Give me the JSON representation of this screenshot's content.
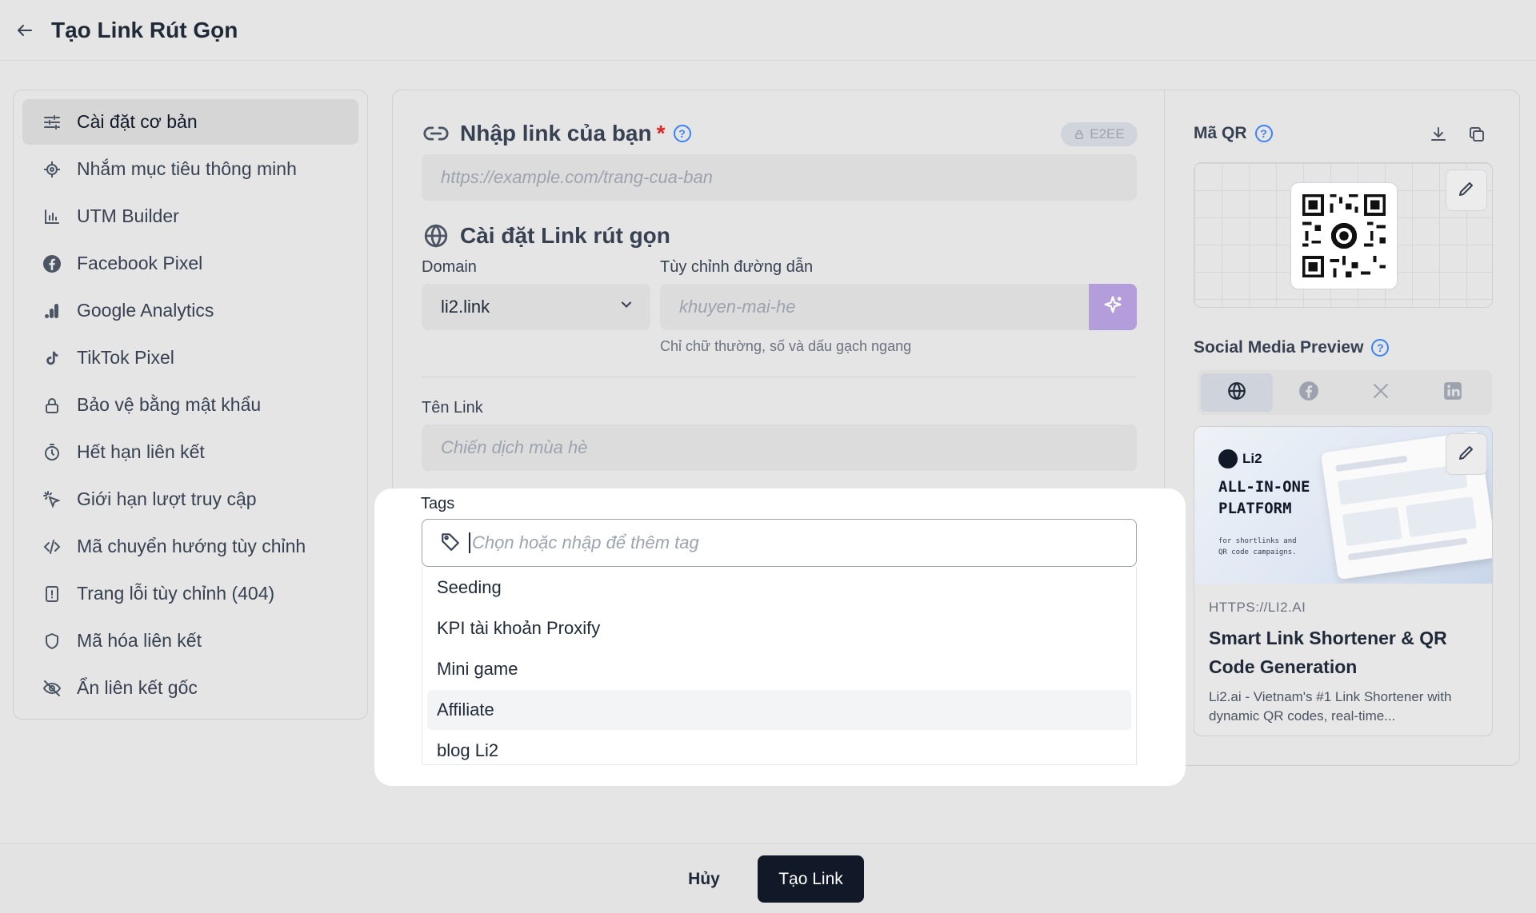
{
  "header": {
    "title": "Tạo Link Rút Gọn"
  },
  "sidebar": {
    "items": [
      {
        "label": "Cài đặt cơ bản",
        "icon": "sliders-icon",
        "active": true
      },
      {
        "label": "Nhắm mục tiêu thông minh",
        "icon": "target-icon"
      },
      {
        "label": "UTM Builder",
        "icon": "bar-chart-icon"
      },
      {
        "label": "Facebook Pixel",
        "icon": "facebook-icon"
      },
      {
        "label": "Google Analytics",
        "icon": "analytics-icon"
      },
      {
        "label": "TikTok Pixel",
        "icon": "tiktok-icon"
      },
      {
        "label": "Bảo vệ bằng mật khẩu",
        "icon": "lock-icon"
      },
      {
        "label": "Hết hạn liên kết",
        "icon": "timer-icon"
      },
      {
        "label": "Giới hạn lượt truy cập",
        "icon": "cursor-click-icon"
      },
      {
        "label": "Mã chuyển hướng tùy chỉnh",
        "icon": "code-icon"
      },
      {
        "label": "Trang lỗi tùy chỉnh (404)",
        "icon": "alert-file-icon"
      },
      {
        "label": "Mã hóa liên kết",
        "icon": "shield-icon"
      },
      {
        "label": "Ẩn liên kết gốc",
        "icon": "eye-off-icon"
      }
    ]
  },
  "main": {
    "link_section": {
      "title": "Nhập link của bạn",
      "required_mark": "*",
      "badge": "E2EE",
      "url_placeholder": "https://example.com/trang-cua-ban"
    },
    "short_section": {
      "title": "Cài đặt Link rút gọn",
      "domain_label": "Domain",
      "domain_value": "li2.link",
      "path_label": "Tùy chỉnh đường dẫn",
      "path_placeholder": "khuyen-mai-he",
      "path_hint": "Chỉ chữ thường, số và dấu gạch ngang"
    },
    "name_section": {
      "label": "Tên Link",
      "placeholder": "Chiến dịch mùa hè"
    },
    "tags": {
      "label": "Tags",
      "placeholder": "Chọn hoặc nhập để thêm tag",
      "options": [
        "Seeding",
        "KPI tài khoản Proxify",
        "Mini game",
        "Affiliate",
        "blog Li2"
      ],
      "highlighted": "Affiliate"
    }
  },
  "right": {
    "qr_title": "Mã QR",
    "social_title": "Social Media Preview",
    "preview": {
      "brand": "Li2",
      "headline_line1": "ALL-IN-ONE",
      "headline_line2": "PLATFORM",
      "sub_line1": "for shortlinks and",
      "sub_line2": "QR code campaigns.",
      "url": "HTTPS://LI2.AI",
      "title": "Smart Link Shortener & QR Code Generation",
      "description": "Li2.ai - Vietnam's #1 Link Shortener with dynamic QR codes, real-time..."
    }
  },
  "footer": {
    "cancel": "Hủy",
    "create": "Tạo Link"
  },
  "colors": {
    "primary_dark": "#111827",
    "accent_purple": "#b39dda",
    "help_blue": "#3b82f6"
  }
}
